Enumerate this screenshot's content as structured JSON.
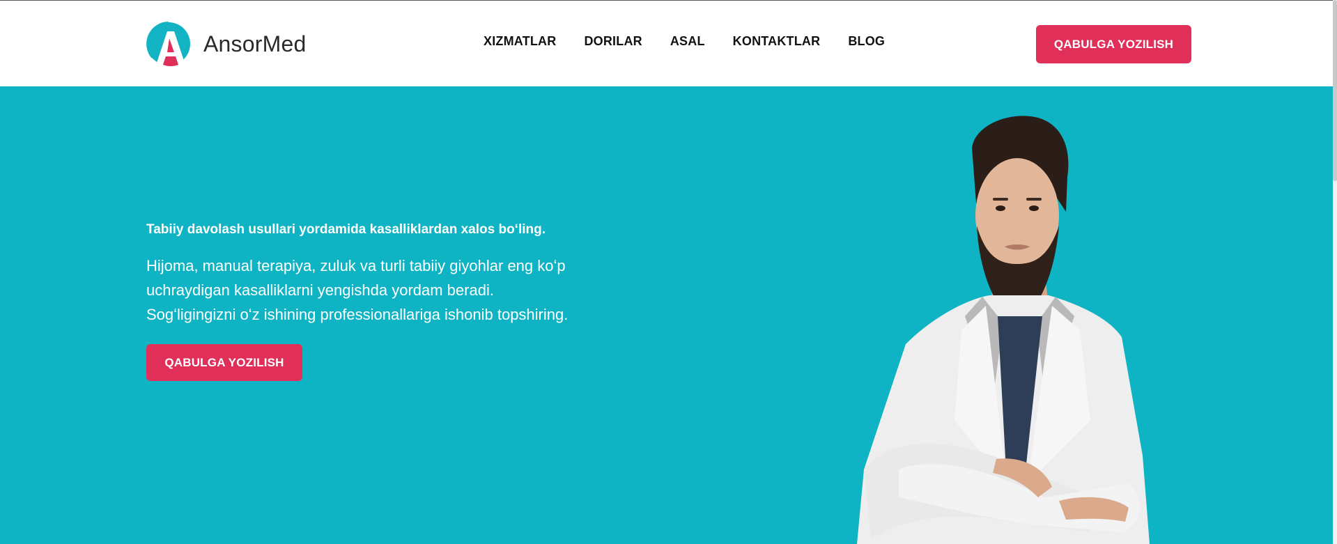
{
  "header": {
    "logo_text": "AnsorMed",
    "nav": [
      "XIZMATLAR",
      "DORILAR",
      "ASAL",
      "KONTAKTLAR",
      "BLOG"
    ],
    "cta_label": "QABULGA YOZILISH"
  },
  "hero": {
    "eyebrow": "Tabiiy davolash usullari yordamida kasalliklardan xalos boʻling.",
    "text_lines": [
      "Hijoma, manual terapiya, zuluk va turli tabiiy giyohlar eng koʻp",
      "uchraydigan kasalliklarni yengishda yordam beradi.",
      "Sogʻligingizni oʻz ishining professionallariga ishonib topshiring."
    ],
    "cta_label": "QABULGA YOZILISH"
  },
  "colors": {
    "accent": "#e0305a",
    "hero_bg": "#0fb4c4",
    "logo_teal": "#12b3c3"
  },
  "icons": {
    "logo": "ansormed-logo-icon"
  }
}
